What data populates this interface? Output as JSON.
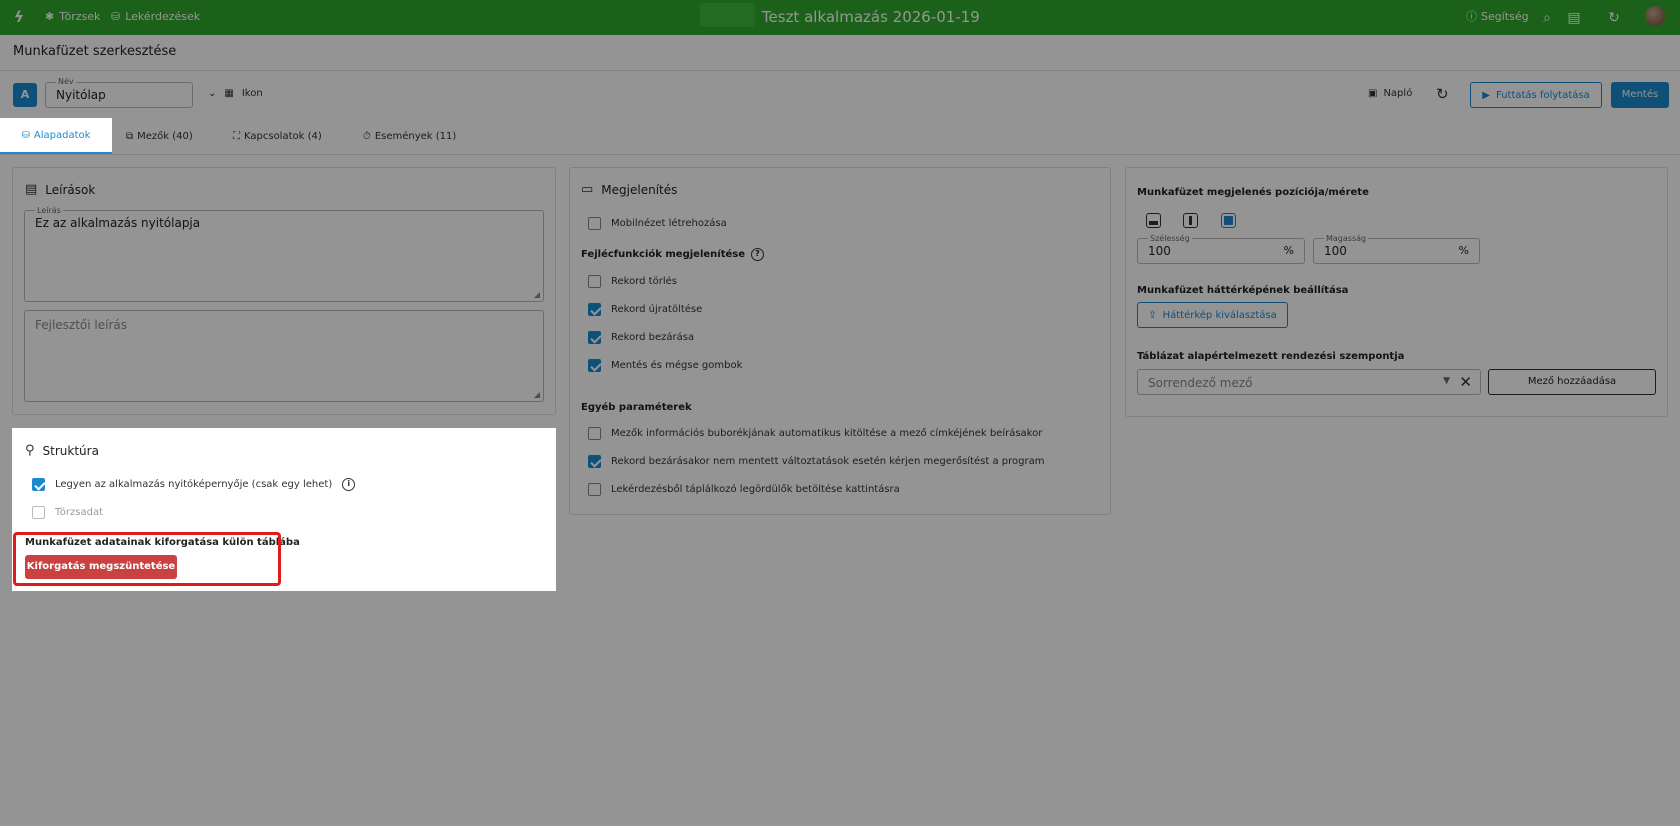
{
  "topbar": {
    "nav": [
      {
        "label": "Törzsek",
        "icon": "asterisk-icon"
      },
      {
        "label": "Lekérdezések",
        "icon": "database-icon"
      }
    ],
    "app_title": "Teszt alkalmazás 2026-01-19",
    "help_label": "Segítség"
  },
  "page": {
    "title": "Munkafüzet szerkesztése"
  },
  "header": {
    "avatar_letter": "A",
    "name_label": "Név",
    "name_value": "Nyitólap",
    "icon_label": "Ikon",
    "log_label": "Napló",
    "run_label": "Futtatás folytatása",
    "save_label": "Mentés"
  },
  "tabs": [
    {
      "label": "Alapadatok"
    },
    {
      "label": "Mezők (40)"
    },
    {
      "label": "Kapcsolatok (4)"
    },
    {
      "label": "Események (11)"
    }
  ],
  "descriptions": {
    "title": "Leírások",
    "desc_label": "Leírás",
    "desc_value": "Ez az alkalmazás nyitólapja",
    "dev_placeholder": "Fejlesztői leírás"
  },
  "structure": {
    "title": "Struktúra",
    "start_screen_label": "Legyen az alkalmazás nyitóképernyője (csak egy lehet)",
    "start_screen_checked": true,
    "master_label": "Törzsadat",
    "master_checked": false,
    "extract_title": "Munkafüzet adatainak kiforgatása külön táblába",
    "extract_button": "Kiforgatás megszüntetése",
    "extract_button_color": "#c94141"
  },
  "display": {
    "title": "Megjelenítés",
    "mobile_label": "Mobilnézet létrehozása",
    "header_section": "Fejlécfunkciók megjelenítése",
    "header_options": [
      {
        "label": "Rekord törlés",
        "checked": false
      },
      {
        "label": "Rekord újratöltése",
        "checked": true
      },
      {
        "label": "Rekord bezárása",
        "checked": true
      },
      {
        "label": "Mentés és mégse gombok",
        "checked": true
      }
    ],
    "other_section": "Egyéb paraméterek",
    "other_options": [
      {
        "label": "Mezők információs buborékjának automatikus kitöltése a mező címkéjének beírásakor",
        "checked": false
      },
      {
        "label": "Rekord bezárásakor nem mentett változtatások esetén kérjen megerősítést a program",
        "checked": true
      },
      {
        "label": "Lekérdezésből táplálkozó legördülők betöltése kattintásra",
        "checked": false
      }
    ]
  },
  "position": {
    "title": "Munkafüzet megjelenés pozíciója/mérete",
    "width_label": "Szélesség",
    "width_value": "100",
    "height_label": "Magasság",
    "height_value": "100",
    "unit": "%",
    "bg_title": "Munkafüzet háttérképének beállítása",
    "bg_button": "Háttérkép kiválasztása",
    "sort_title": "Táblázat alapértelmezett rendezési szempontja",
    "sort_placeholder": "Sorrendező mező",
    "add_field_button": "Mező hozzáadása"
  },
  "colors": {
    "topbar": "#2fa82d",
    "accent": "#1a8bd0",
    "danger": "#c94141",
    "highlight": "#e01b1b"
  }
}
